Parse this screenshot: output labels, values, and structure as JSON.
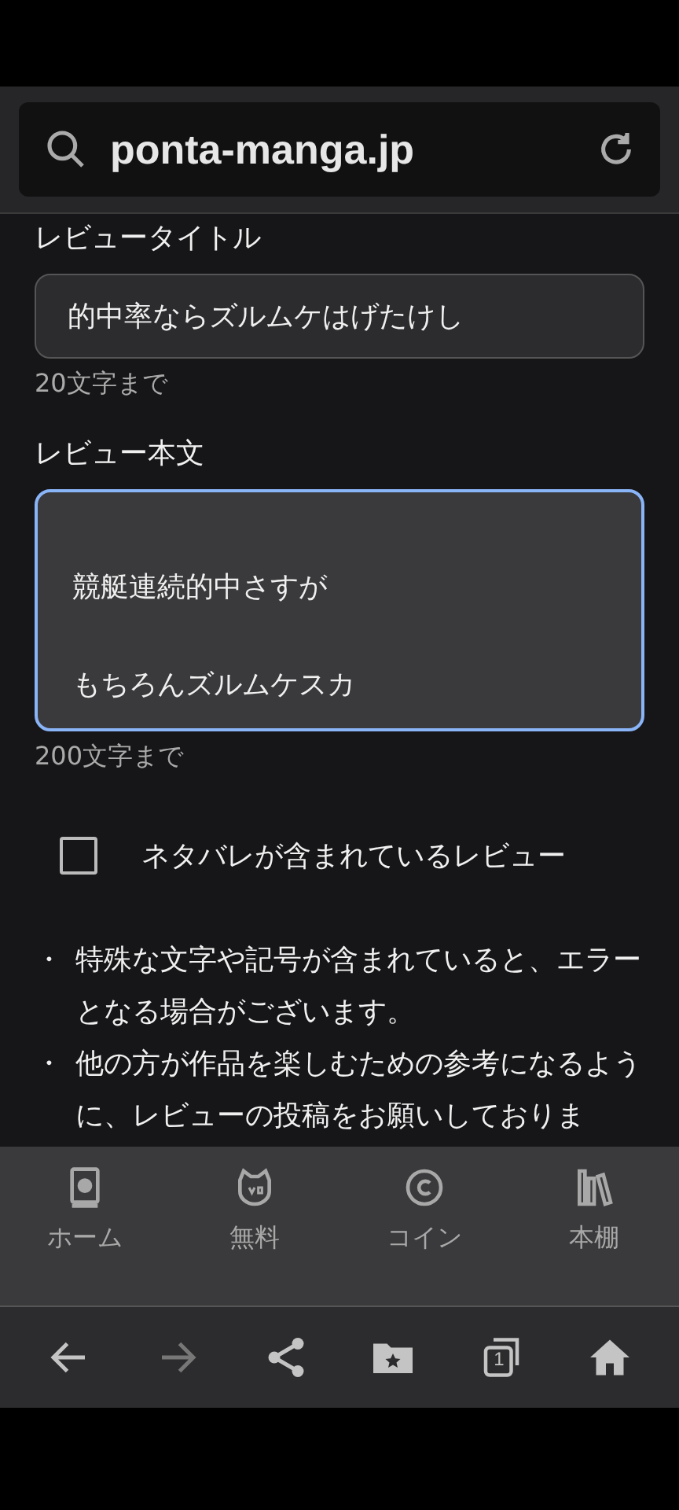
{
  "address_bar": {
    "url": "ponta-manga.jp"
  },
  "form": {
    "title_label": "レビュータイトル",
    "title_value": "的中率ならズルムケはげたけし",
    "title_hint": "20文字まで",
    "body_label": "レビュー本文",
    "body_lines": [
      "競艇連続的中さすが",
      "もちろんズルムケスカ"
    ],
    "body_focused": true,
    "body_hint": "200文字まで",
    "spoiler": {
      "label": "ネタバレが含まれているレビュー",
      "checked": false
    },
    "notes": [
      {
        "bullet": "・",
        "text": "特殊な文字や記号が含まれていると、エラーとなる場合がございます。"
      },
      {
        "bullet": "・",
        "text": "他の方が作品を楽しむための参考になるように、レビューの投稿をお願いしておりま"
      }
    ]
  },
  "tab_bar": [
    {
      "kind": "home",
      "label": "ホーム"
    },
    {
      "kind": "free",
      "label": "無料"
    },
    {
      "kind": "coin",
      "label": "コイン"
    },
    {
      "kind": "shelf",
      "label": "本棚"
    }
  ],
  "browser_nav": [
    {
      "kind": "back",
      "disabled": false
    },
    {
      "kind": "forward",
      "disabled": true
    },
    {
      "kind": "share",
      "disabled": false
    },
    {
      "kind": "bookmarks",
      "disabled": false
    },
    {
      "kind": "tabs",
      "count": "1",
      "disabled": false
    },
    {
      "kind": "home",
      "disabled": false
    }
  ]
}
